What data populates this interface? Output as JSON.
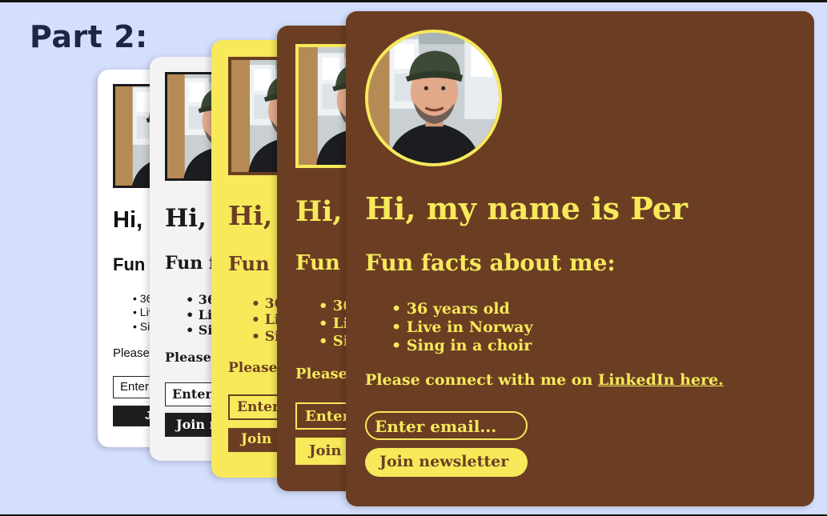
{
  "page": {
    "heading": "Part 2:"
  },
  "profile": {
    "greeting": "Hi, my name is Per",
    "facts_heading": "Fun facts about me:",
    "facts": [
      "36 years old",
      "Live in Norway",
      "Sing in a choir"
    ],
    "connect_text": "Please connect with me on ",
    "connect_link": "LinkedIn here.",
    "email_placeholder": "Enter email...",
    "button_label": "Join newsletter"
  },
  "colors": {
    "page_background": "#d4dffd",
    "heading_text": "#1f2547",
    "brown": "#6b3e23",
    "yellow": "#f7e95a",
    "white": "#ffffff",
    "light_gray": "#f3f3f3",
    "dark": "#1e1e1e"
  },
  "icons": {
    "avatar": "profile-photo-icon"
  }
}
